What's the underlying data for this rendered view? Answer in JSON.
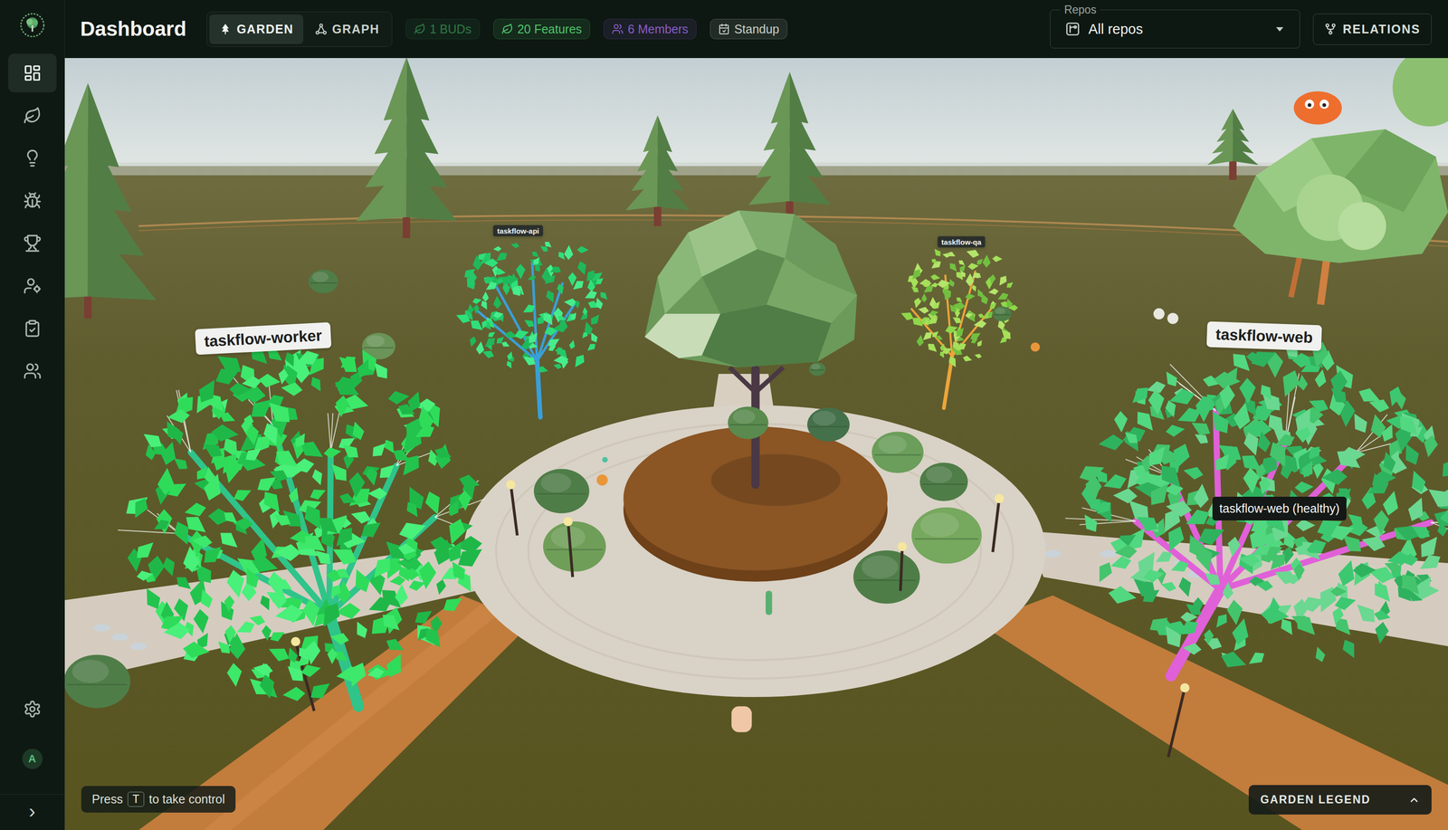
{
  "app": {
    "title": "Dashboard"
  },
  "view_tabs": [
    {
      "label": "GARDEN",
      "selected": true
    },
    {
      "label": "GRAPH",
      "selected": false
    }
  ],
  "badges": [
    {
      "label": "1 BUDs",
      "color": "#2e7a48"
    },
    {
      "label": "20 Features",
      "color": "#4fc56c"
    },
    {
      "label": "6 Members",
      "color": "#8a5cc8"
    },
    {
      "label": "Standup",
      "color": "#c9cfcb"
    }
  ],
  "repos": {
    "legend": "Repos",
    "value": "All repos"
  },
  "relations_button": "RELATIONS",
  "sidebar": {
    "items": [
      {
        "selected": true
      },
      {
        "selected": false
      },
      {
        "selected": false
      },
      {
        "selected": false
      },
      {
        "selected": false
      },
      {
        "selected": false
      },
      {
        "selected": false
      },
      {
        "selected": false
      }
    ],
    "avatar": "A",
    "expand": "›"
  },
  "trees": [
    {
      "label": "taskflow-worker",
      "color": "#2fc48a"
    },
    {
      "label": "taskflow-api",
      "color": "#3a9fd8"
    },
    {
      "label": "taskflow-qa",
      "color": "#eba53a"
    },
    {
      "label": "taskflow-web",
      "color": "#e060d8"
    }
  ],
  "tooltip": {
    "text": "taskflow-web (healthy)"
  },
  "hint": {
    "before": "Press",
    "key": "T",
    "after": "to take control"
  },
  "legend": {
    "label": "GARDEN LEGEND",
    "expanded": false
  }
}
